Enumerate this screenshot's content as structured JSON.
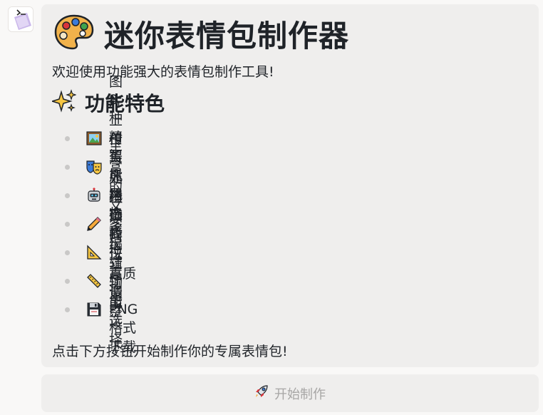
{
  "app": {
    "title": "迷你表情包制作器",
    "title_icon": "palette-icon",
    "welcome": "欢迎使用功能强大的表情包制作工具!"
  },
  "features": {
    "heading": "功能特色",
    "heading_icon": "sparkles-icon",
    "items": [
      {
        "label": "图片上传与处理",
        "icon": "picture-icon"
      },
      {
        "label": "8种精美风格选择",
        "icon": "theater-masks-icon"
      },
      {
        "label": "AI智能风格转换",
        "icon": "robot-icon"
      },
      {
        "label": "丰富的文字编辑功能",
        "icon": "pencil-icon"
      },
      {
        "label": "精确的位置调整",
        "icon": "triangle-ruler-icon"
      },
      {
        "label": "多尺寸输出选择",
        "icon": "ruler-icon"
      },
      {
        "label": "高质量PNG格式下载",
        "icon": "floppy-disk-icon"
      }
    ]
  },
  "footer": {
    "prompt": "点击下方按钮开始制作你的专属表情包!"
  },
  "start_button": {
    "label": "开始制作",
    "icon": "rocket-icon"
  },
  "colors": {
    "card_bg": "#efeeed",
    "page_bg": "#f9f8f7",
    "text": "#1f2328",
    "button_text_disabled": "#a7a6a5",
    "bullet": "#c9c8c7"
  }
}
